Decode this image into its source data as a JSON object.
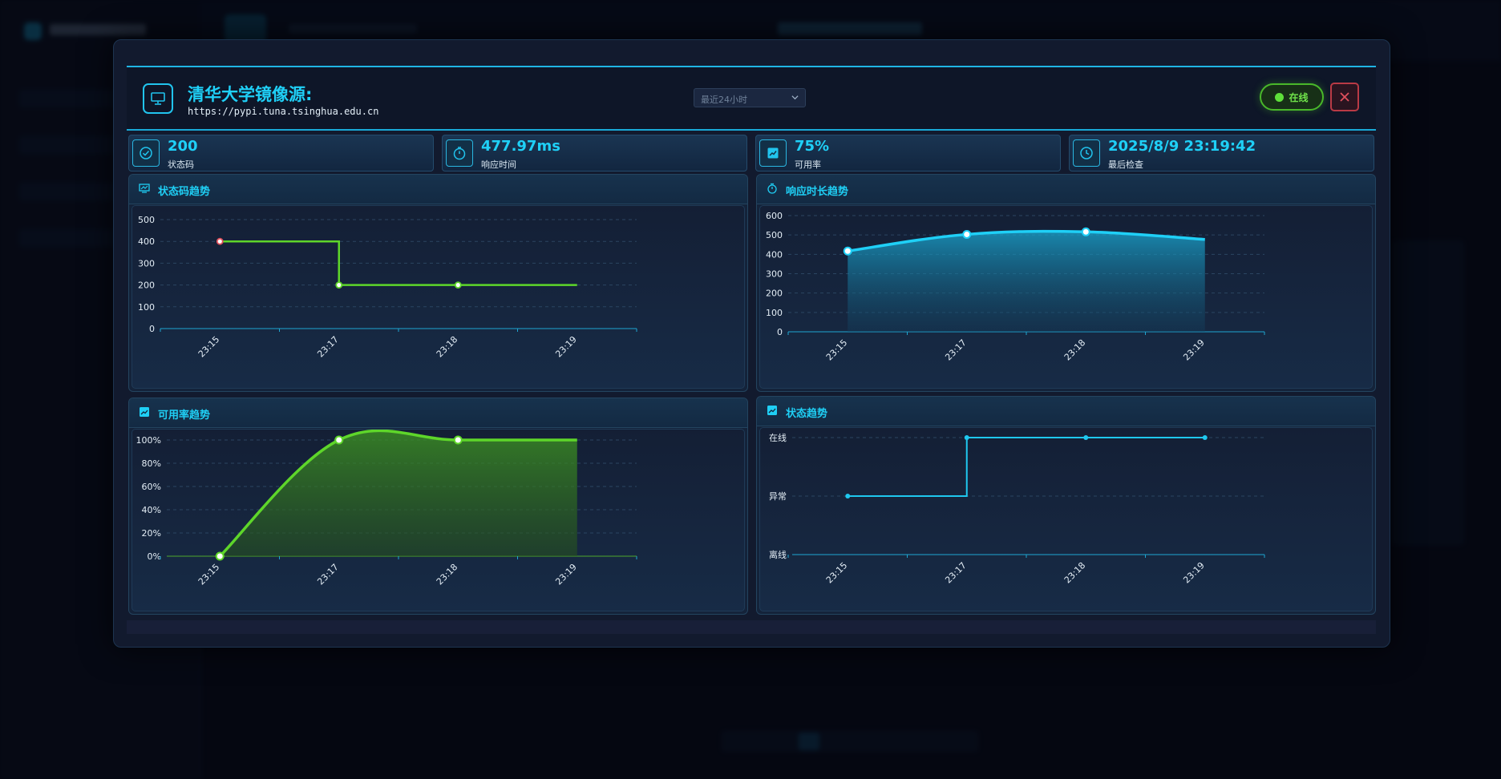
{
  "modal": {
    "title": "清华大学镜像源:",
    "url": "https://pypi.tuna.tsinghua.edu.cn",
    "time_range": "最近24小时",
    "status": "在线",
    "colors": {
      "accent": "#1fd0f7",
      "online": "#5ee03a",
      "danger": "#d9414f"
    }
  },
  "stats": [
    {
      "icon": "check-circle-icon",
      "value": "200",
      "label": "状态码"
    },
    {
      "icon": "stopwatch-icon",
      "value": "477.97ms",
      "label": "响应时间"
    },
    {
      "icon": "chart-icon",
      "value": "75%",
      "label": "可用率"
    },
    {
      "icon": "clock-icon",
      "value": "2025/8/9 23:19:42",
      "label": "最后检查"
    }
  ],
  "chart_data": [
    {
      "type": "line",
      "title": "状态码趋势",
      "categories": [
        "23:15",
        "23:17",
        "23:18",
        "23:19"
      ],
      "yticks": [
        "0",
        "100",
        "200",
        "300",
        "400",
        "500"
      ],
      "ylim": [
        0,
        500
      ],
      "step": "end",
      "series": [
        {
          "values": [
            400,
            200,
            200,
            200
          ]
        }
      ],
      "color": "#5ed62a"
    },
    {
      "type": "area",
      "title": "响应时长趋势",
      "categories": [
        "23:15",
        "23:17",
        "23:18",
        "23:19"
      ],
      "yticks": [
        "0",
        "100",
        "200",
        "300",
        "400",
        "500",
        "600"
      ],
      "ylim": [
        0,
        600
      ],
      "series": [
        {
          "values": [
            417,
            503,
            516,
            477
          ]
        }
      ],
      "color": "#1fd0f7"
    },
    {
      "type": "area",
      "title": "可用率趋势",
      "categories": [
        "23:15",
        "23:17",
        "23:18",
        "23:19"
      ],
      "yticks": [
        "0%",
        "20%",
        "40%",
        "60%",
        "80%",
        "100%"
      ],
      "ylim": [
        0,
        100
      ],
      "series": [
        {
          "values": [
            0,
            100,
            100,
            100
          ]
        }
      ],
      "color": "#5ed62a"
    },
    {
      "type": "line",
      "title": "状态趋势",
      "categories": [
        "23:15",
        "23:17",
        "23:18",
        "23:19"
      ],
      "yticks": [
        "离线",
        "异常",
        "在线"
      ],
      "ylim": [
        0,
        2
      ],
      "step": "end",
      "series": [
        {
          "values": [
            1,
            2,
            2,
            2
          ]
        }
      ],
      "color": "#1fc8ef"
    }
  ]
}
